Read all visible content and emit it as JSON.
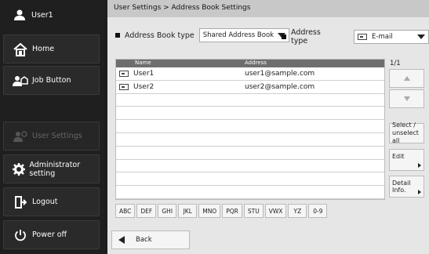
{
  "sidebar": {
    "user": "User1",
    "items": [
      {
        "label": "Home",
        "icon": "home-icon"
      },
      {
        "label": "Job Button",
        "icon": "job-button-icon"
      },
      {
        "label": "User Settings",
        "icon": "user-settings-icon",
        "enabled": false
      },
      {
        "label": "Administrator setting",
        "icon": "gear-icon"
      },
      {
        "label": "Logout",
        "icon": "logout-icon"
      },
      {
        "label": "Power off",
        "icon": "power-icon"
      }
    ]
  },
  "breadcrumb": "User Settings > Address Book Settings",
  "filters": {
    "book_type_label": "Address Book type",
    "book_type_value": "Shared Address Book",
    "address_type_label": "Address type",
    "address_type_value": "E-mail"
  },
  "list": {
    "columns": [
      "Name",
      "Address"
    ],
    "rows": [
      {
        "name": "User1",
        "address": "user1@sample.com"
      },
      {
        "name": "User2",
        "address": "user2@sample.com"
      }
    ],
    "page": "1/1"
  },
  "side_buttons": {
    "select": "Select / unselect all",
    "edit": "Edit",
    "detail": "Detail Info."
  },
  "index_tabs": [
    "ABC",
    "DEF",
    "GHI",
    "JKL",
    "MNO",
    "PQR",
    "STU",
    "VWX",
    "YZ",
    "0-9"
  ],
  "back_label": "Back"
}
